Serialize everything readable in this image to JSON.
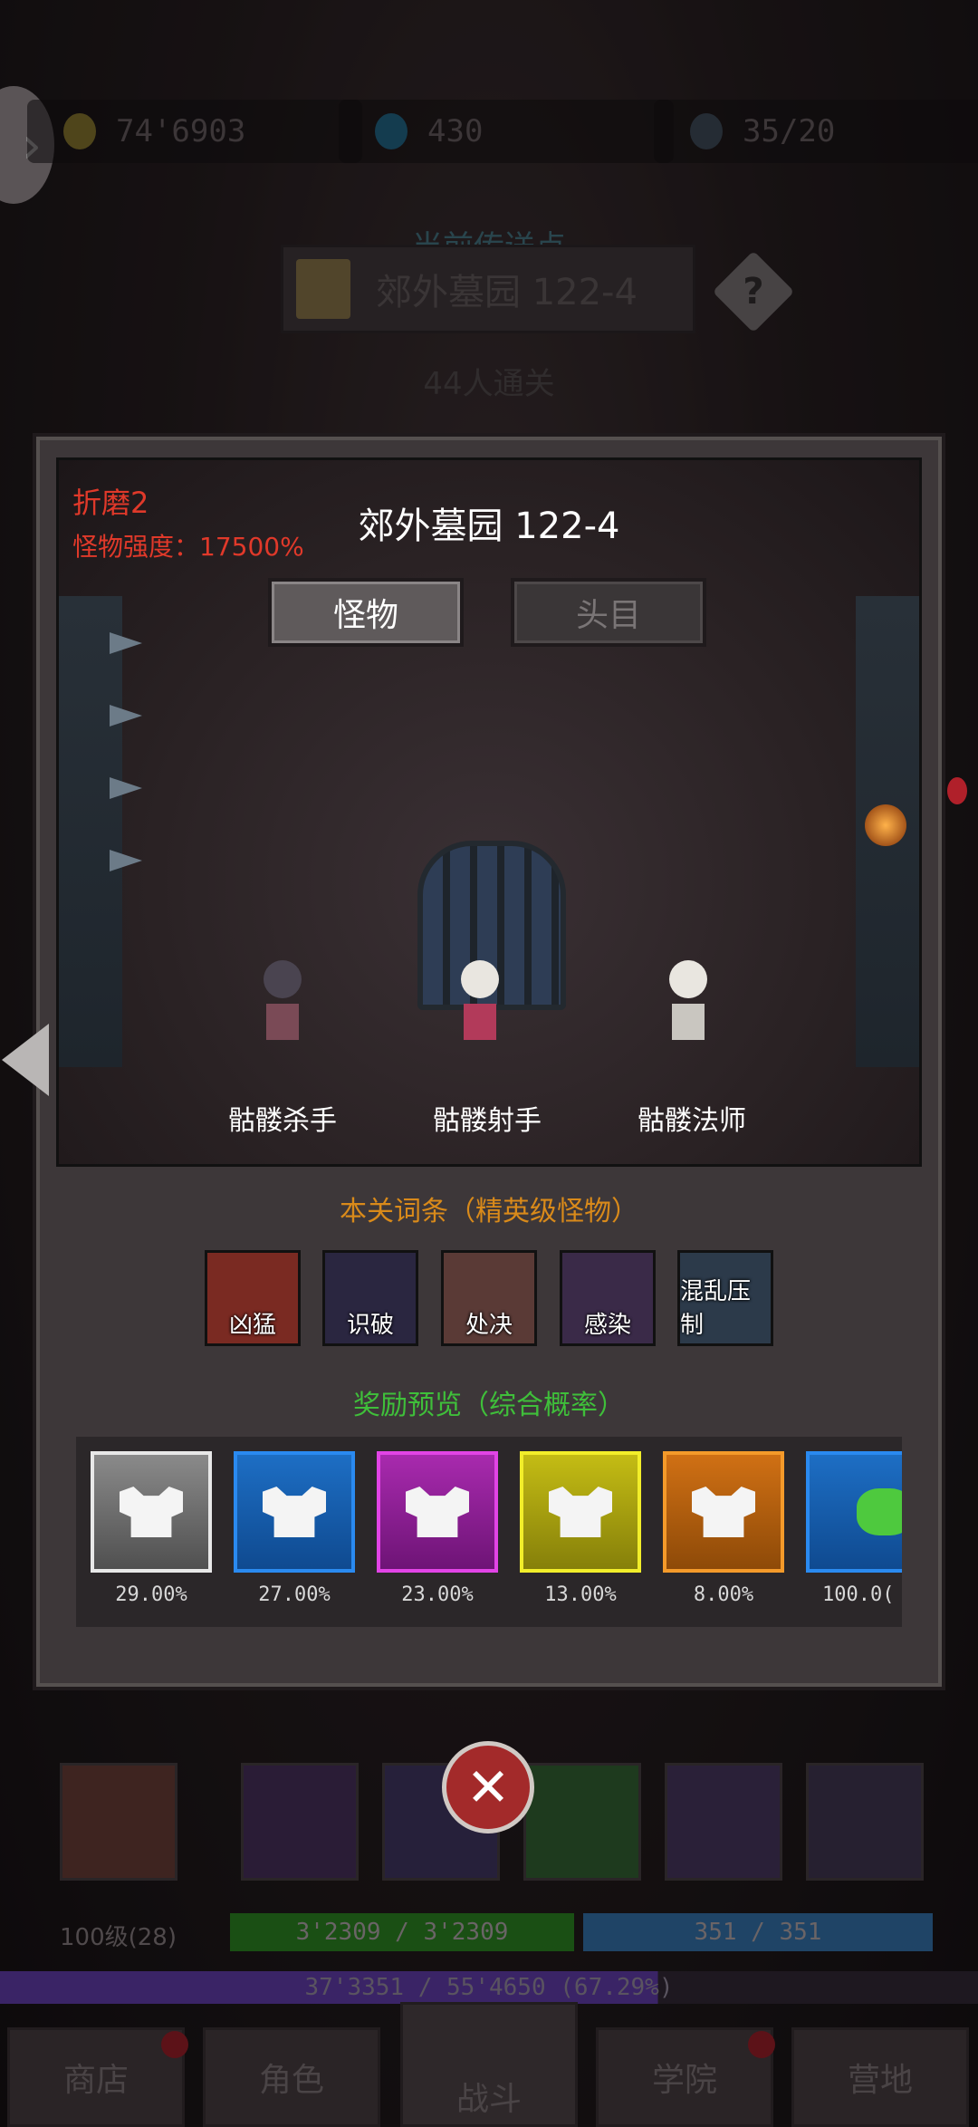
{
  "currencies": [
    {
      "value": "74'6903",
      "icon": "gold-coin-icon",
      "color": "#8a7a2a"
    },
    {
      "value": "430",
      "icon": "blue-gem-icon",
      "color": "#1f5c7a"
    },
    {
      "value": "35/20",
      "icon": "feather-icon",
      "color": "#445566"
    }
  ],
  "teleport": {
    "label": "当前传送点",
    "location": "郊外墓园 122-4",
    "cleared": "44人通关"
  },
  "stage": {
    "difficulty": "折磨2",
    "monster_power": "怪物强度：17500%",
    "title": "郊外墓园 122-4",
    "tabs": [
      "怪物",
      "头目"
    ],
    "active_tab": "怪物",
    "monsters": [
      "骷髅杀手",
      "骷髅射手",
      "骷髅法师"
    ]
  },
  "affixes": {
    "title": "本关词条（精英级怪物）",
    "items": [
      {
        "label": "凶猛",
        "icon": "bear-icon",
        "color": "#7a2a22"
      },
      {
        "label": "识破",
        "icon": "eye-icon",
        "color": "#2a2640"
      },
      {
        "label": "处决",
        "icon": "axe-icon",
        "color": "#5a3a36"
      },
      {
        "label": "感染",
        "icon": "virus-icon",
        "color": "#3a2a48"
      },
      {
        "label": "混乱压制",
        "icon": "chaos-rune-icon",
        "color": "#2c3a4a"
      }
    ]
  },
  "rewards": {
    "title": "奖励预览（综合概率）",
    "items": [
      {
        "pct": "29.00%",
        "icon": "armor-icon",
        "rarity_color": "#b5b5b5",
        "bg": "#6a6a6a"
      },
      {
        "pct": "27.00%",
        "icon": "armor-icon",
        "rarity_color": "#2a7fe0",
        "bg": "#155aa8"
      },
      {
        "pct": "23.00%",
        "icon": "armor-icon",
        "rarity_color": "#d43ad8",
        "bg": "#8e1e96"
      },
      {
        "pct": "13.00%",
        "icon": "armor-icon",
        "rarity_color": "#e6e21e",
        "bg": "#a7a010"
      },
      {
        "pct": "8.00%",
        "icon": "armor-icon",
        "rarity_color": "#f08a1c",
        "bg": "#b25d0c"
      },
      {
        "pct": "100.0(",
        "icon": "green-gem-icon",
        "rarity_color": "#2a7fe0",
        "bg": "#155aa8"
      }
    ]
  },
  "player": {
    "level": "100级(28)",
    "hp": "3'2309 / 3'2309",
    "mp": "351 / 351",
    "exp": "37'3351 / 55'4650 (67.29%)",
    "exp_fraction": 0.6729
  },
  "nav": [
    "商店",
    "角色",
    "战斗",
    "学院",
    "营地"
  ],
  "close_label": "✕"
}
